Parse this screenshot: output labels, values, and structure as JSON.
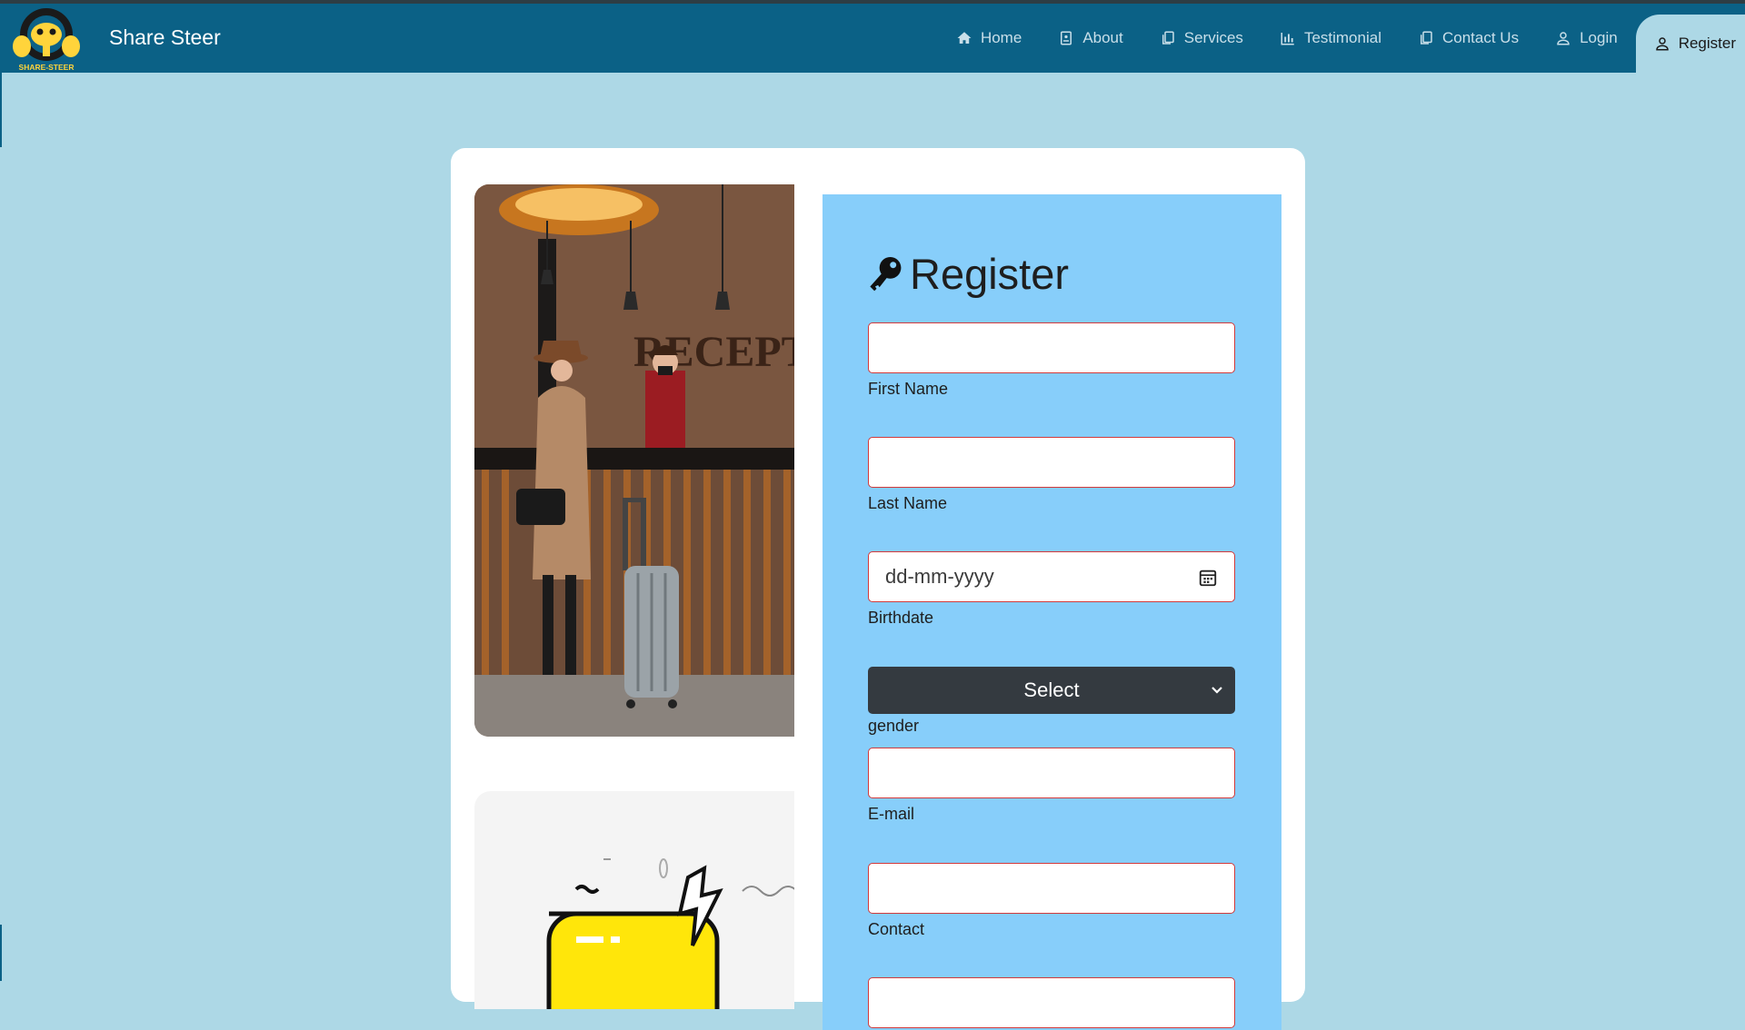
{
  "brand": {
    "name": "Share Steer",
    "logo_text": "SHARE-STEER"
  },
  "nav": {
    "items": [
      {
        "label": "Home",
        "icon": "home-icon"
      },
      {
        "label": "About",
        "icon": "document-icon"
      },
      {
        "label": "Services",
        "icon": "copy-icon"
      },
      {
        "label": "Testimonial",
        "icon": "bar-chart-icon"
      },
      {
        "label": "Contact Us",
        "icon": "copy-icon"
      },
      {
        "label": "Login",
        "icon": "user-icon"
      },
      {
        "label": "Register",
        "icon": "user-icon",
        "active": true
      }
    ]
  },
  "form": {
    "title": "Register",
    "title_icon": "key-icon",
    "fields": [
      {
        "label": "First Name",
        "value": ""
      },
      {
        "label": "Last Name",
        "value": ""
      },
      {
        "label": "Birthdate",
        "placeholder": "dd-mm-yyyy"
      },
      {
        "label": "gender",
        "selected": "Select"
      },
      {
        "label": "E-mail",
        "value": ""
      },
      {
        "label": "Contact",
        "value": ""
      }
    ]
  },
  "colors": {
    "page_bg": "#add8e6",
    "navbar": "#0b6186",
    "form_panel": "#87cefa",
    "field_border": "#d23a3a",
    "select_bg": "#343a40"
  }
}
